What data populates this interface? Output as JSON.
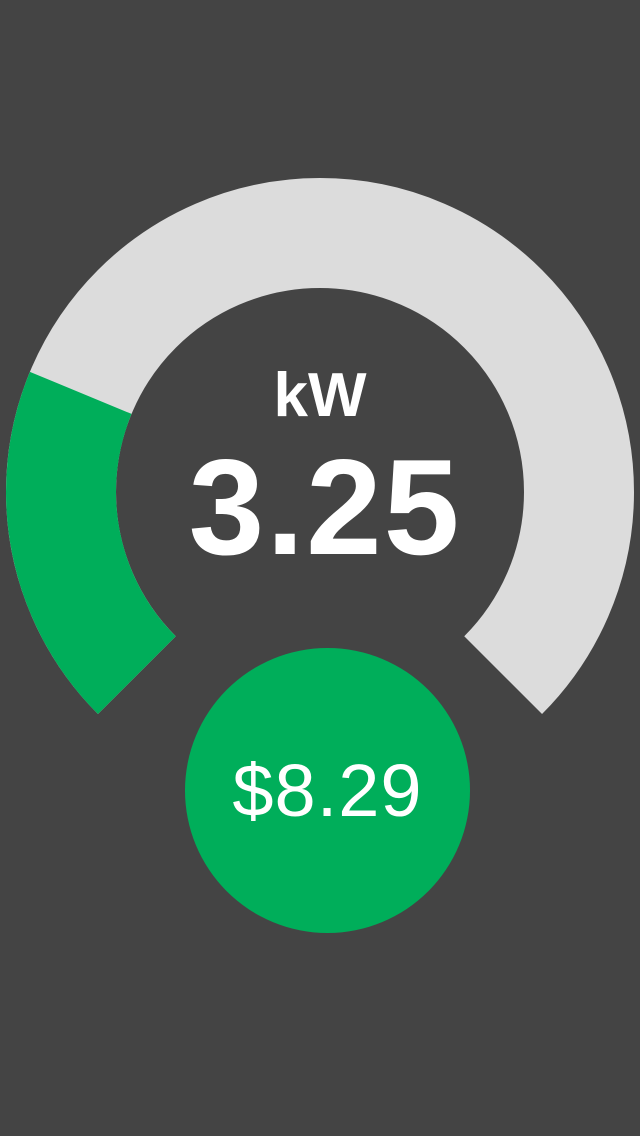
{
  "colors": {
    "background": "#444444",
    "gauge_track": "#dcdcdc",
    "gauge_fill": "#00ae5a",
    "text": "#ffffff",
    "badge": "#00ae5a"
  },
  "gauge": {
    "unit": "kW",
    "value": "3.25",
    "fill_fraction": 0.25
  },
  "cost": {
    "value": "$8.29"
  }
}
